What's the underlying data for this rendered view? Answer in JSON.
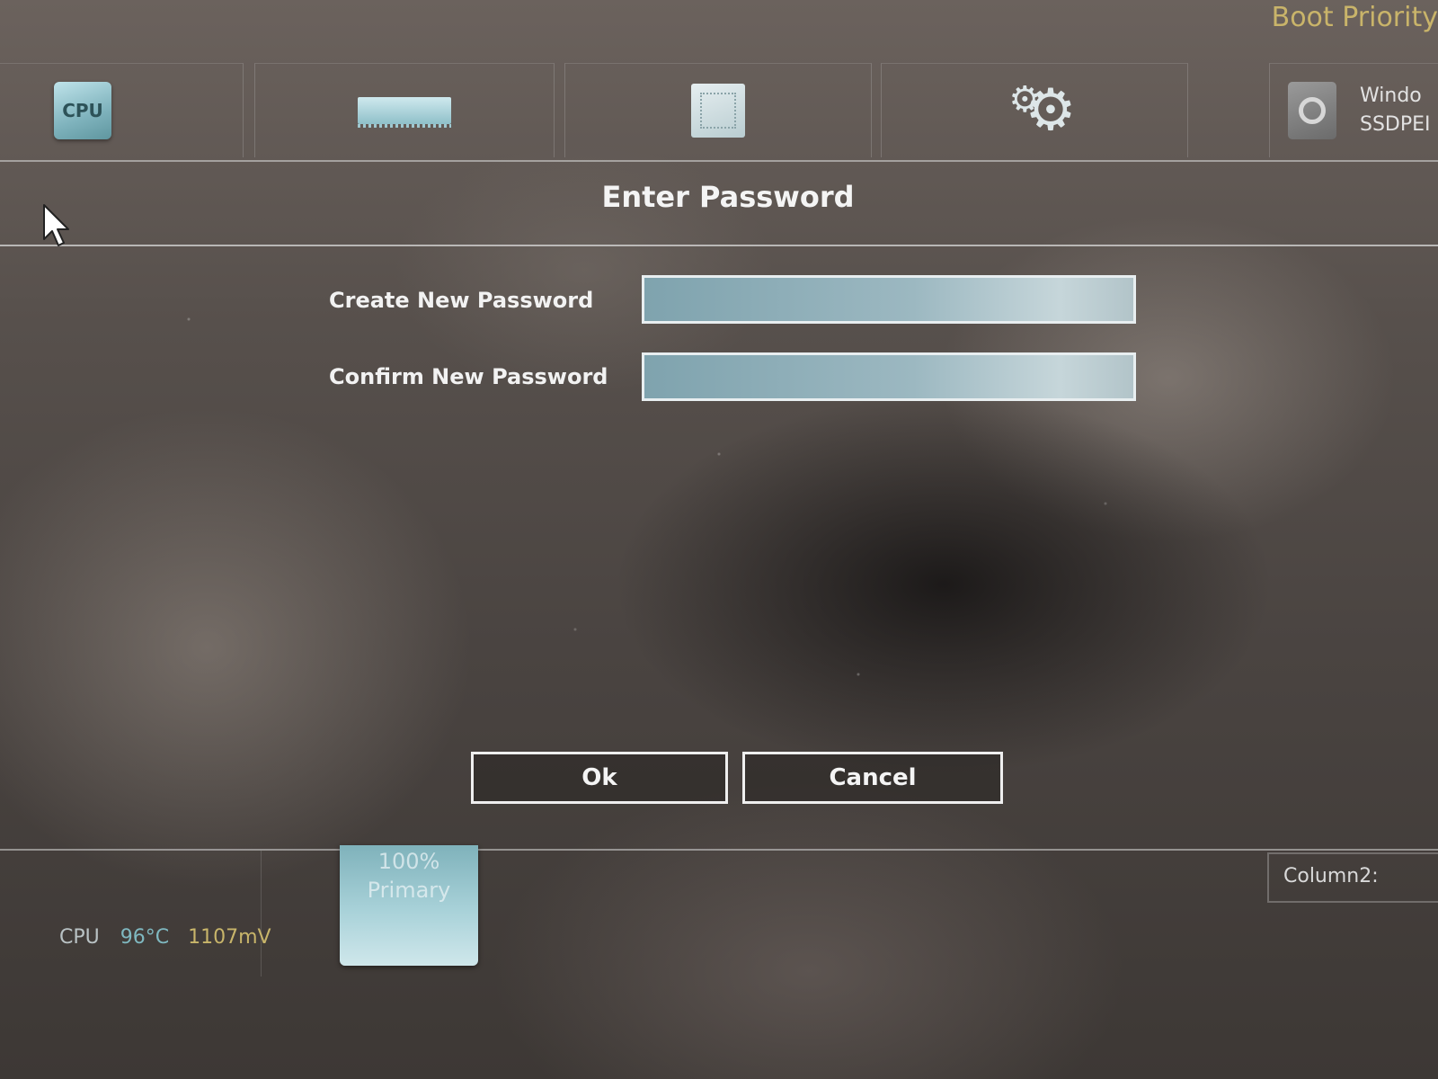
{
  "header": {
    "boot_priority": "Boot Priority",
    "tabs": [
      {
        "name": "cpu",
        "icon": "cpu-chip-icon",
        "label": "CPU"
      },
      {
        "name": "memory",
        "icon": "memory-stick-icon"
      },
      {
        "name": "chipset",
        "icon": "motherboard-chip-icon"
      },
      {
        "name": "settings",
        "icon": "gears-icon"
      }
    ],
    "boot_device": {
      "icon": "hard-disk-icon",
      "line1": "Windo",
      "line2": "SSDPEI"
    }
  },
  "dialog": {
    "title": "Enter Password",
    "fields": [
      {
        "label": "Create New Password",
        "value": ""
      },
      {
        "label": "Confirm New Password",
        "value": ""
      }
    ],
    "ok_label": "Ok",
    "cancel_label": "Cancel"
  },
  "status": {
    "cpu_label": "CPU",
    "cpu_temp": "96°C",
    "cpu_voltage": "1107mV",
    "usage_percent": "100%",
    "usage_label": "Primary",
    "column_label": "Column2:"
  },
  "colors": {
    "accent_gold": "#c9b46a",
    "accent_cyan": "#7fb8c0",
    "text_white": "#f2f2f2"
  }
}
